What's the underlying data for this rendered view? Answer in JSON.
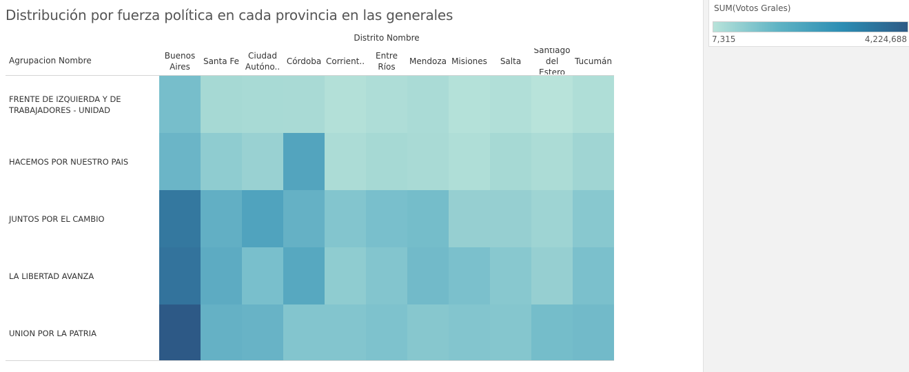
{
  "title": "Distribución por fuerza política en cada provincia en las generales",
  "column_group_label": "Distrito Nombre",
  "row_header_label": "Agrupacion Nombre",
  "legend": {
    "title": "SUM(Votos Grales)",
    "min_label": "7,315",
    "max_label": "4,224,688",
    "color_low": "#b8e3da",
    "color_high": "#2d5a85"
  },
  "chart_data": {
    "type": "heatmap",
    "measure": "SUM(Votos Grales)",
    "x_label": "Distrito Nombre",
    "y_label": "Agrupacion Nombre",
    "columns": [
      "Buenos\nAires",
      "Santa Fe",
      "Ciudad\nAutóno..",
      "Córdoba",
      "Corrient..",
      "Entre Ríos",
      "Mendoza",
      "Misiones",
      "Salta",
      "Santiago\ndel Estero",
      "Tucumán"
    ],
    "rows": [
      "FRENTE DE IZQUIERDA Y DE TRABAJADORES - UNIDAD",
      "HACEMOS POR NUESTRO PAIS",
      "JUNTOS POR EL CAMBIO",
      "LA LIBERTAD AVANZA",
      "UNION POR LA PATRIA"
    ],
    "values": [
      [
        420000,
        60000,
        50000,
        45000,
        12000,
        25000,
        40000,
        10000,
        15000,
        7315,
        20000
      ],
      [
        600000,
        200000,
        130000,
        1050000,
        30000,
        60000,
        45000,
        20000,
        60000,
        30000,
        90000
      ],
      [
        2700000,
        750000,
        1100000,
        700000,
        300000,
        400000,
        450000,
        150000,
        150000,
        100000,
        250000
      ],
      [
        2900000,
        850000,
        400000,
        950000,
        200000,
        300000,
        500000,
        380000,
        250000,
        150000,
        380000
      ],
      [
        4224688,
        700000,
        650000,
        300000,
        300000,
        350000,
        260000,
        300000,
        280000,
        450000,
        500000
      ]
    ],
    "color_range": [
      7315,
      4224688
    ]
  }
}
